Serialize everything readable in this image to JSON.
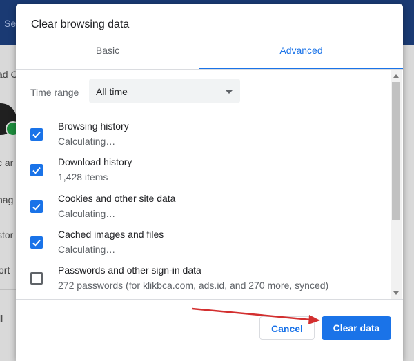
{
  "background": {
    "header_text": "Se",
    "lines": [
      "ad C",
      "c ar",
      "nag",
      "stor",
      "ort",
      "ll"
    ]
  },
  "dialog": {
    "title": "Clear browsing data",
    "tabs": [
      {
        "label": "Basic",
        "active": false
      },
      {
        "label": "Advanced",
        "active": true
      }
    ],
    "time_range": {
      "label": "Time range",
      "value": "All time"
    },
    "items": [
      {
        "label": "Browsing history",
        "detail": "Calculating…",
        "checked": true
      },
      {
        "label": "Download history",
        "detail": "1,428 items",
        "checked": true
      },
      {
        "label": "Cookies and other site data",
        "detail": "Calculating…",
        "checked": true
      },
      {
        "label": "Cached images and files",
        "detail": "Calculating…",
        "checked": true
      },
      {
        "label": "Passwords and other sign-in data",
        "detail": "272 passwords (for klikbca.com, ads.id, and 270 more, synced)",
        "checked": false
      }
    ],
    "buttons": {
      "cancel": "Cancel",
      "clear": "Clear data"
    }
  },
  "colors": {
    "accent": "#1a73e8",
    "annotation_arrow": "#d32f2f"
  }
}
